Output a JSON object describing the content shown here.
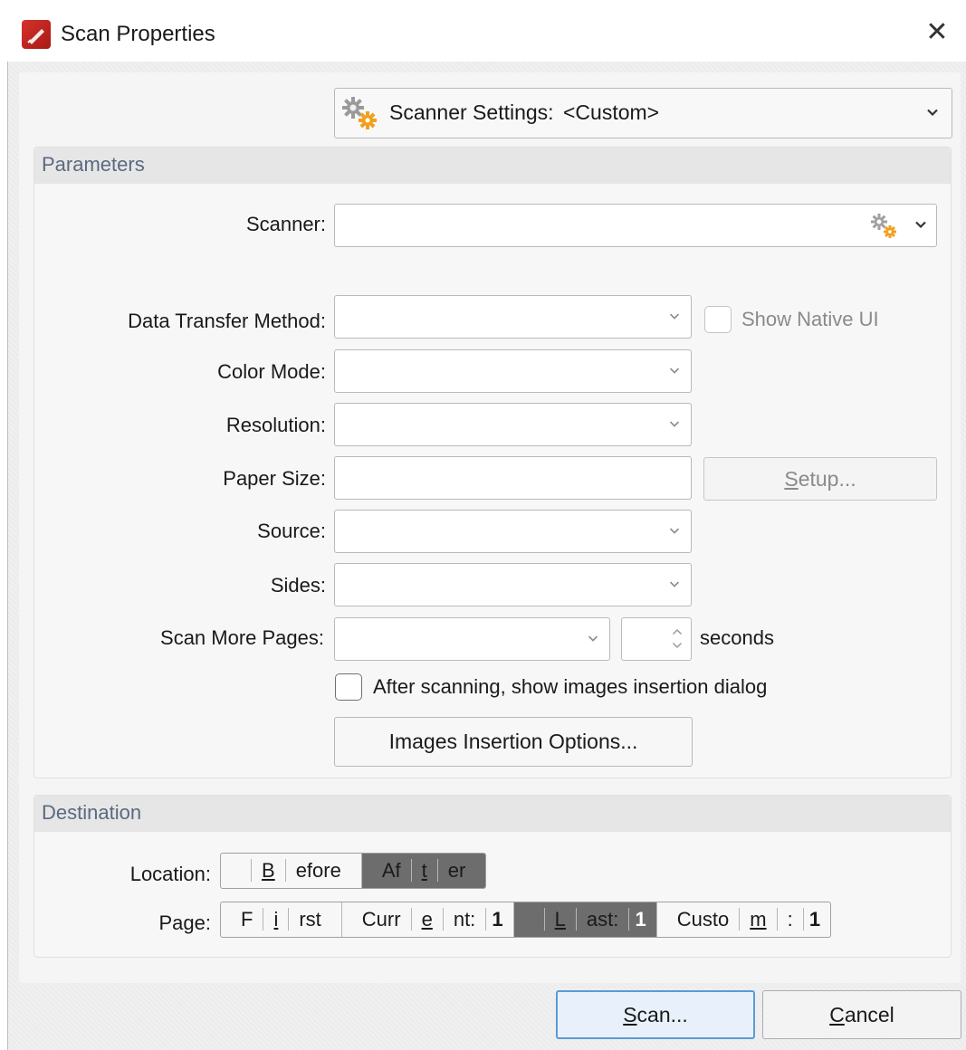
{
  "window": {
    "title": "Scan Properties",
    "close_glyph": "✕"
  },
  "scanner_settings": {
    "label": "Scanner Settings:",
    "value": "<Custom>"
  },
  "parameters": {
    "title": "Parameters",
    "scanner_label": "Scanner:",
    "data_transfer_label": "Data Transfer Method:",
    "show_native_ui": "Show Native UI",
    "color_mode_label": "Color Mode:",
    "resolution_label": "Resolution:",
    "paper_size_label": "Paper Size:",
    "setup_button": {
      "pre": "",
      "accel": "S",
      "post": "etup..."
    },
    "source_label": "Source:",
    "sides_label": "Sides:",
    "scan_more_label": "Scan More Pages:",
    "seconds": "seconds",
    "after_scan": "After scanning, show images insertion dialog",
    "insertion_options": "Images Insertion Options..."
  },
  "destination": {
    "title": "Destination",
    "location_label": "Location:",
    "location_options": [
      {
        "pre": "",
        "accel": "B",
        "post": "efore",
        "selected": false
      },
      {
        "pre": "Af",
        "accel": "t",
        "post": "er",
        "selected": true
      }
    ],
    "page_label": "Page:",
    "page_options": [
      {
        "pre": "F",
        "accel": "i",
        "post": "rst",
        "value": "",
        "selected": false
      },
      {
        "pre": "Curr",
        "accel": "e",
        "post": "nt:",
        "value": "1",
        "selected": false
      },
      {
        "pre": "",
        "accel": "L",
        "post": "ast:",
        "value": "1",
        "selected": true
      },
      {
        "pre": "Custo",
        "accel": "m",
        "post": ":",
        "value": "1",
        "selected": false
      }
    ]
  },
  "footer": {
    "scan": {
      "pre": "",
      "accel": "S",
      "post": "can..."
    },
    "cancel": {
      "pre": "",
      "accel": "C",
      "post": "ancel"
    }
  },
  "icons": {
    "app": "pdf-editor-icon",
    "settings": "gears-icon",
    "close": "close-icon"
  }
}
